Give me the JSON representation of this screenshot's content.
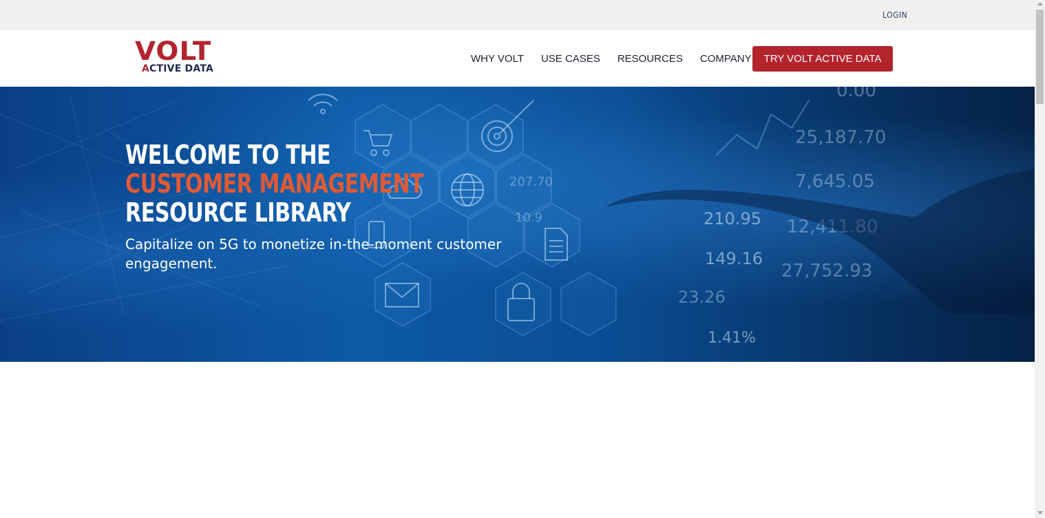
{
  "topbar": {
    "login_label": "LOGIN"
  },
  "brand": {
    "logo_main": "VOLT",
    "logo_sub_a": "A",
    "logo_sub_rest": "CTIVE DATA",
    "primary_color": "#b3242d",
    "dark_color": "#1d2a4d"
  },
  "nav": {
    "items": [
      {
        "label": "WHY VOLT"
      },
      {
        "label": "USE CASES"
      },
      {
        "label": "RESOURCES"
      },
      {
        "label": "COMPANY"
      }
    ],
    "cta_label": "TRY VOLT ACTIVE DATA"
  },
  "hero": {
    "title_line1": "WELCOME TO THE",
    "title_line2": "CUSTOMER MANAGEMENT",
    "title_line3": "RESOURCE LIBRARY",
    "subtitle": "Capitalize on 5G to monetize in-the-moment customer engagement.",
    "accent_color": "#e05a35",
    "background_numbers": [
      "0.00",
      "25,187.70",
      "7,645.05",
      "210.95",
      "12,411.80",
      "149.16",
      "27,752.93",
      "23.26",
      "1.41%",
      "207.70",
      "10.9"
    ],
    "icons": [
      "wifi-icon",
      "cart-icon",
      "target-icon",
      "cloud-icon",
      "globe-icon",
      "phone-icon",
      "document-icon",
      "mail-icon",
      "lock-icon"
    ]
  }
}
